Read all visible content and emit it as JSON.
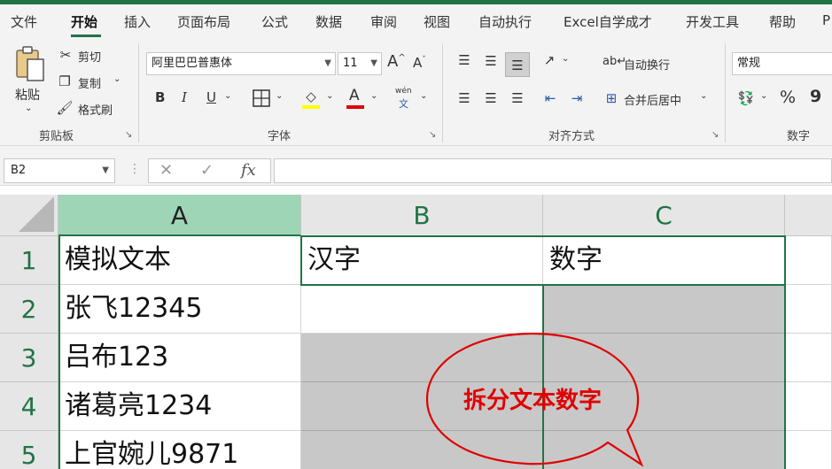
{
  "tabs": [
    "文件",
    "开始",
    "插入",
    "页面布局",
    "公式",
    "数据",
    "审阅",
    "视图",
    "自动执行",
    "Excel自学成才",
    "开发工具",
    "帮助",
    "P"
  ],
  "active_tab": "开始",
  "clipboard": {
    "paste": "粘贴",
    "cut": "剪切",
    "copy": "复制",
    "format_painter": "格式刷",
    "label": "剪贴板"
  },
  "font": {
    "name": "阿里巴巴普惠体",
    "size": "11",
    "grow": "A",
    "shrink": "A",
    "bold": "B",
    "italic": "I",
    "underline": "U",
    "font_color_letter": "A",
    "phonetic_top": "wén",
    "phonetic_bottom": "文",
    "label": "字体"
  },
  "alignment": {
    "wrap_text": "自动换行",
    "merge_center": "合并后居中",
    "label": "对齐方式"
  },
  "number": {
    "format": "常规",
    "percent": "%",
    "comma": "9",
    "label": "数字"
  },
  "formula_bar": {
    "name_box": "B2",
    "cancel": "✕",
    "enter": "✓",
    "fx": "fx",
    "value": ""
  },
  "sheet": {
    "columns": [
      "A",
      "B",
      "C"
    ],
    "selected_column": "A",
    "rows": [
      "1",
      "2",
      "3",
      "4",
      "5"
    ],
    "cells": [
      [
        "模拟文本",
        "汉字",
        "数字"
      ],
      [
        "张飞12345",
        "",
        ""
      ],
      [
        "吕布123",
        "",
        ""
      ],
      [
        "诸葛亮1234",
        "",
        ""
      ],
      [
        "上官婉儿9871",
        "",
        ""
      ]
    ]
  },
  "callout": {
    "text": "拆分文本数字",
    "color": "#e00000"
  },
  "colors": {
    "accent": "#217346",
    "selected_header": "#9fd5b7",
    "gray_fill": "#c8c8c8",
    "font_highlight": "#ffff00",
    "font_color": "#e00000"
  }
}
